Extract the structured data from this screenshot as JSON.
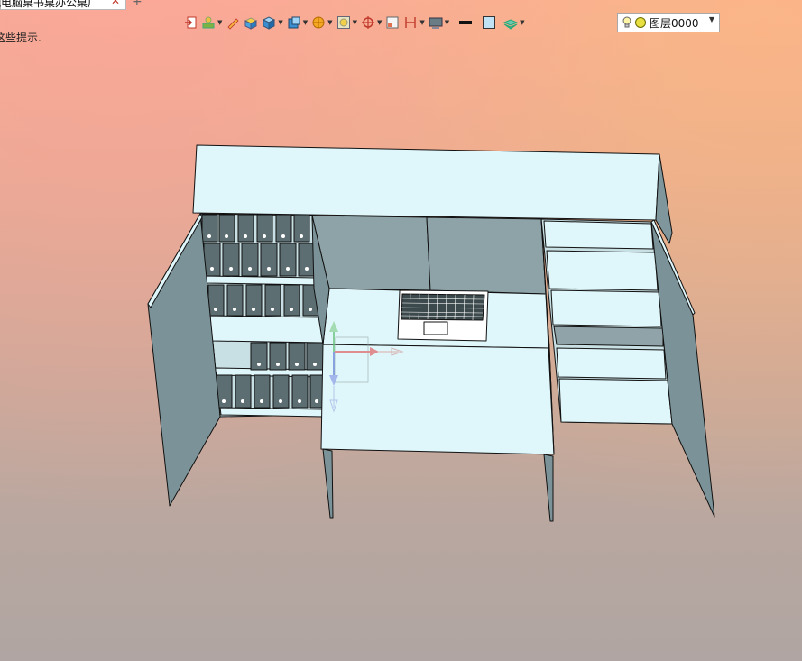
{
  "tabs": {
    "active_label": "式电脑桌书桌办公桌厂",
    "close_glyph": "✕",
    "add_glyph": "+"
  },
  "viewport": {
    "hint_text": "这些提示."
  },
  "toolbar": {
    "buttons": [
      {
        "name": "exit-sketch-icon",
        "dropdown": false
      },
      {
        "name": "assembly-icon",
        "dropdown": true
      },
      {
        "name": "pencil-icon",
        "dropdown": false
      },
      {
        "name": "box-yellow-icon",
        "dropdown": false
      },
      {
        "name": "cube-blue-icon",
        "dropdown": true
      },
      {
        "name": "view-cube-icon",
        "dropdown": true
      },
      {
        "name": "render-mode-icon",
        "dropdown": true
      },
      {
        "name": "view-orientation-icon",
        "dropdown": true
      },
      {
        "name": "target-icon",
        "dropdown": true
      },
      {
        "name": "section-view-icon",
        "dropdown": false
      },
      {
        "name": "measure-icon",
        "dropdown": true
      },
      {
        "name": "display-icon",
        "dropdown": true
      },
      {
        "name": "line-color-icon",
        "dropdown": false
      },
      {
        "name": "fill-color-icon",
        "dropdown": false
      },
      {
        "name": "layer-manager-icon",
        "dropdown": true
      }
    ],
    "layer": {
      "label": "图层0000",
      "arrow": "▼"
    }
  },
  "colors": {
    "face_light": "#dff6fa",
    "face_side": "#7f979c",
    "face_back": "#8fa3a8",
    "edge": "#111111"
  }
}
